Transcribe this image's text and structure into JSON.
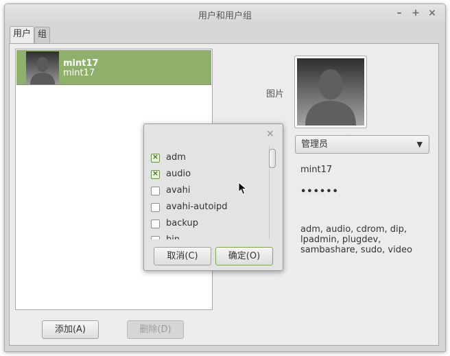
{
  "window": {
    "title": "用户和用户组",
    "controls": [
      "–",
      "+",
      "×"
    ]
  },
  "tabs": [
    {
      "label": "用户",
      "active": true
    },
    {
      "label": "组",
      "active": false
    }
  ],
  "users": [
    {
      "name": "mint17",
      "login": "mint17",
      "selected": true
    }
  ],
  "buttons": {
    "add": "添加(A)",
    "delete": "删除(D)"
  },
  "details": {
    "picture_label": "图片",
    "account_type": "管理员",
    "username": "mint17",
    "password": "••••••",
    "groups": "adm, audio, cdrom, dip, lpadmin, plugdev, sambashare, sudo, video"
  },
  "group_dialog": {
    "close": "×",
    "items": [
      {
        "label": "adm",
        "checked": true
      },
      {
        "label": "audio",
        "checked": true
      },
      {
        "label": "avahi",
        "checked": false
      },
      {
        "label": "avahi-autoipd",
        "checked": false
      },
      {
        "label": "backup",
        "checked": false
      },
      {
        "label": "bin",
        "checked": false
      }
    ],
    "cancel": "取消(C)",
    "ok": "确定(O)"
  },
  "colors": {
    "selection": "#8fb06a",
    "window_bg": "#d6d6d6",
    "panel_bg": "#ececec",
    "ok_border": "#7ea356"
  }
}
